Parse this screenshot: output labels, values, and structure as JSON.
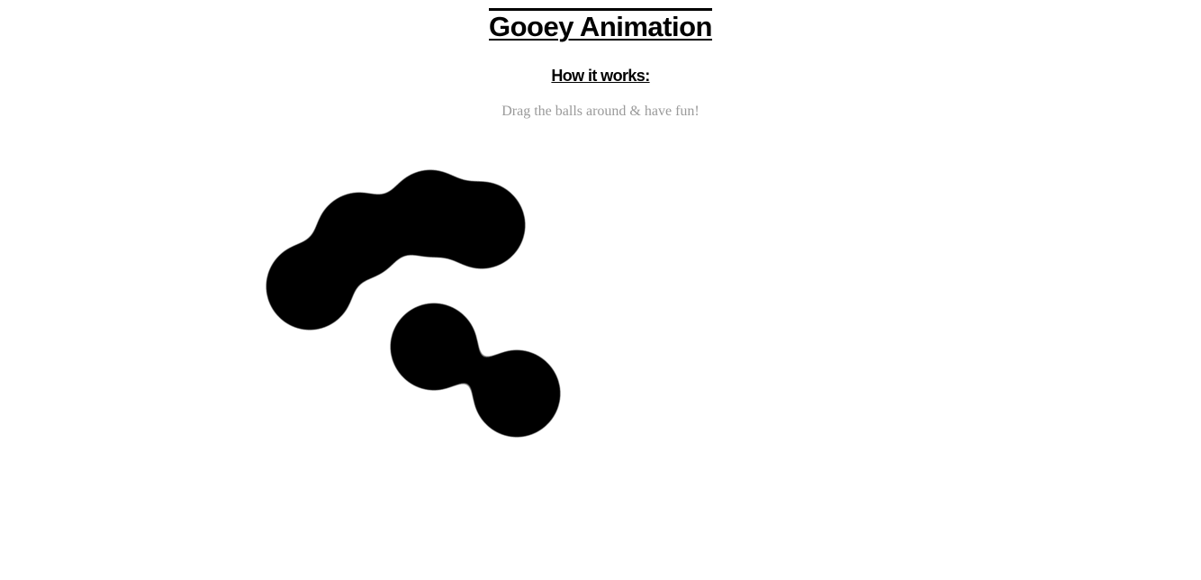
{
  "header": {
    "title": "Gooey Animation",
    "subtitle": "How it works:",
    "instructions": "Drag the balls around & have fun!"
  },
  "colors": {
    "ball": "#000000",
    "background": "#ffffff",
    "instructions_text": "#9a9a9a"
  },
  "balls": {
    "count": 6
  }
}
